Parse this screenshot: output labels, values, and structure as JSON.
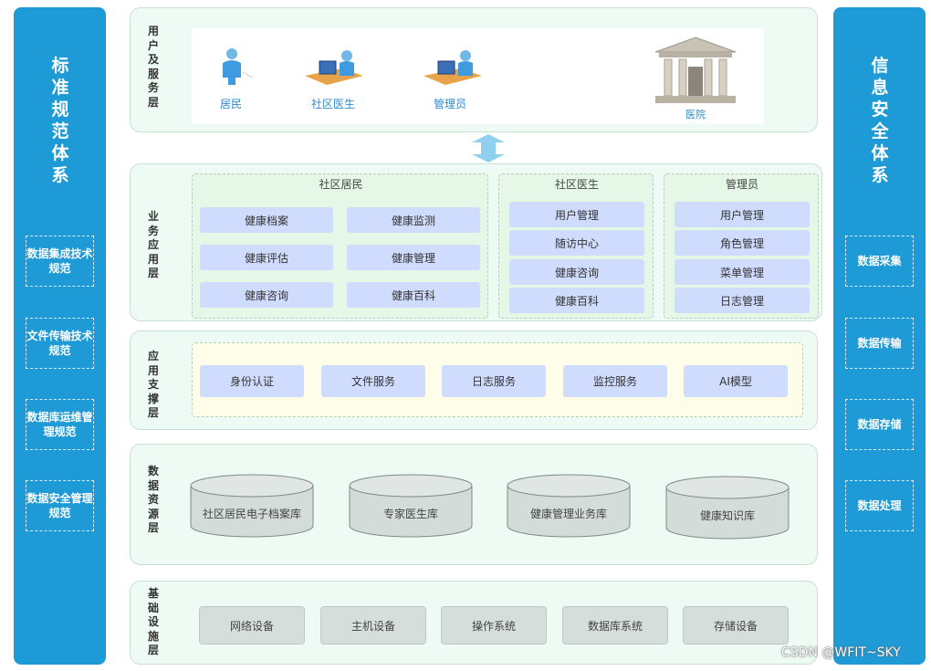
{
  "left_column": {
    "title": "标准规范体系",
    "items": [
      "数据集成技术规范",
      "文件传输技术规范",
      "数据库运维管理规范",
      "数据安全管理规范"
    ]
  },
  "right_column": {
    "title": "信息安全体系",
    "items": [
      "数据采集",
      "数据传输",
      "数据存储",
      "数据处理"
    ]
  },
  "user_layer": {
    "label": "用户及服务层",
    "roles": [
      "居民",
      "社区医生",
      "管理员"
    ],
    "hospital": "医院"
  },
  "business_layer": {
    "label": "业务应用层",
    "groups": [
      {
        "title": "社区居民",
        "items": [
          "健康档案",
          "健康监测",
          "健康评估",
          "健康管理",
          "健康咨询",
          "健康百科"
        ]
      },
      {
        "title": "社区医生",
        "items": [
          "用户管理",
          "随访中心",
          "健康咨询",
          "健康百科"
        ]
      },
      {
        "title": "管理员",
        "items": [
          "用户管理",
          "角色管理",
          "菜单管理",
          "日志管理"
        ]
      }
    ]
  },
  "support_layer": {
    "label": "应用支撑层",
    "items": [
      "身份认证",
      "文件服务",
      "日志服务",
      "监控服务",
      "AI模型"
    ]
  },
  "data_layer": {
    "label": "数据资源层",
    "databases": [
      "社区居民电子档案库",
      "专家医生库",
      "健康管理业务库",
      "健康知识库"
    ]
  },
  "infra_layer": {
    "label": "基础设施层",
    "items": [
      "网络设备",
      "主机设备",
      "操作系统",
      "数据库系统",
      "存储设备"
    ]
  },
  "watermark": "CSDN @WFIT~SKY",
  "colors": {
    "side": "#1e9ad6",
    "layer_bg": "#eefbf5",
    "button": "#cfdcfd",
    "infra": "#d6dedb",
    "arrow": "#8fd0ef"
  }
}
